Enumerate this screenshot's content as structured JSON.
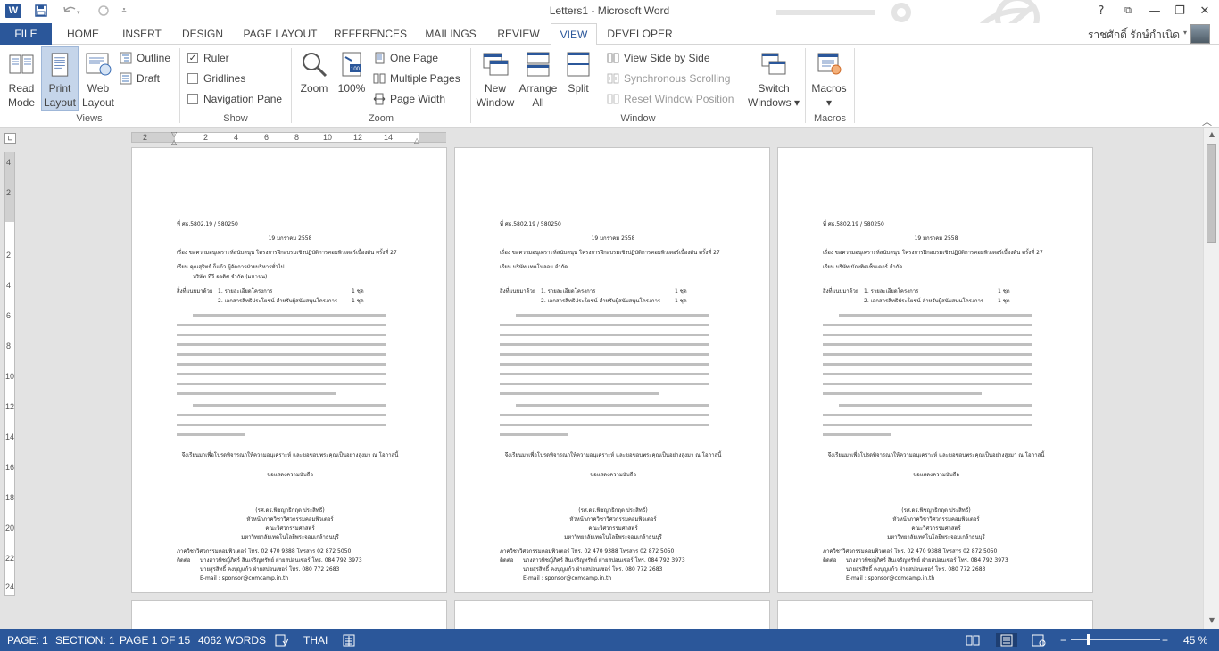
{
  "app": {
    "title": "Letters1 - Microsoft Word",
    "logo": "W",
    "colors": {
      "accent": "#2b579a",
      "ribbon_bg": "#ffffff",
      "workspace_bg": "#e3e3e3"
    }
  },
  "quick_access": {
    "save_icon": "save-icon",
    "undo_icon": "undo-icon",
    "redo_icon": "redo-icon",
    "customize_icon": "customize-qat-icon"
  },
  "window_controls": {
    "help": "?",
    "restore_ribbon": "⧉",
    "minimize": "—",
    "maximize": "❐",
    "close": "✕"
  },
  "tabs": {
    "file": "FILE",
    "items": [
      {
        "label": "HOME"
      },
      {
        "label": "INSERT"
      },
      {
        "label": "DESIGN"
      },
      {
        "label": "PAGE LAYOUT"
      },
      {
        "label": "REFERENCES"
      },
      {
        "label": "MAILINGS"
      },
      {
        "label": "REVIEW"
      },
      {
        "label": "VIEW",
        "active": true
      },
      {
        "label": "DEVELOPER"
      }
    ],
    "user_name": "ราชศักดิ์ รักษ์กำเนิด"
  },
  "ribbon": {
    "views": {
      "label": "Views",
      "read_mode": [
        "Read",
        "Mode"
      ],
      "print_layout": [
        "Print",
        "Layout"
      ],
      "web_layout": [
        "Web",
        "Layout"
      ],
      "outline": "Outline",
      "draft": "Draft"
    },
    "show": {
      "label": "Show",
      "ruler": "Ruler",
      "ruler_checked": true,
      "gridlines": "Gridlines",
      "gridlines_checked": false,
      "navigation_pane": "Navigation Pane",
      "navigation_pane_checked": false
    },
    "zoom": {
      "label": "Zoom",
      "zoom": "Zoom",
      "hundred": "100%",
      "one_page": "One Page",
      "multiple_pages": "Multiple Pages",
      "page_width": "Page Width"
    },
    "window": {
      "label": "Window",
      "new_window": [
        "New",
        "Window"
      ],
      "arrange_all": [
        "Arrange",
        "All"
      ],
      "split": "Split",
      "view_side_by_side": "View Side by Side",
      "synchronous_scrolling": "Synchronous Scrolling",
      "reset_window_position": "Reset Window Position",
      "switch_windows": [
        "Switch",
        "Windows ▾"
      ]
    },
    "macros": {
      "label": "Macros",
      "macros": [
        "Macros",
        "▾"
      ]
    }
  },
  "ruler": {
    "horizontal_numbers": [
      "2",
      "2",
      "4",
      "6",
      "8",
      "10",
      "12",
      "14"
    ],
    "vertical_numbers": [
      "4",
      "2",
      "2",
      "4",
      "6",
      "8",
      "10",
      "12",
      "14",
      "16",
      "18",
      "20",
      "22",
      "24"
    ]
  },
  "pages": [
    {
      "ref": "ที่ ศธ.5802.19 / 580250",
      "date": "19 มกราคม 2558",
      "subject": "เรื่อง   ขอความอนุเคราะห์สนับสนุน โครงการฝึกอบรมเชิงปฏิบัติการคอมพิวเตอร์เบื้องต้น ครั้งที่ 27",
      "to": "เรียน  คุณสุริทธ์ ก็แก้ว ผู้จัดการฝ่ายบริหารทั่วไป",
      "to2": "บริษัท ทีวี ออดิศ จำกัด (มหาชน)",
      "attach_label": "สิ่งที่แนบมาด้วย",
      "attach1": "1. รายละเอียดโครงการ",
      "attach2": "2. เอกสารสิทธิประโยชน์ สำหรับผู้สนับสนุนโครงการ",
      "qty": "1 ชุด",
      "closing": "จึงเรียนมาเพื่อโปรดพิจารณาให้ความอนุเคราะห์ และขอขอบพระคุณเป็นอย่างสูงมา ณ โอกาสนี้",
      "regards": "ขอแสดงความนับถือ",
      "signer": "(รศ.ดร.พิชญาธิกฤต ประสิทธิ์)",
      "position1": "หัวหน้าภาควิชาวิศวกรรมคอมพิวเตอร์",
      "position2": "คณะวิศวกรรมศาสตร์",
      "position3": "มหาวิทยาลัยเทคโนโลยีพระจอมเกล้าธนบุรี",
      "dept": "ภาควิชาวิศวกรรมคอมพิวเตอร์  โทร. 02 470 9388  โทรสาร 02 872 5050",
      "contact_label": "ติดต่อ",
      "contact1": "นางสาวพิชญ์ภิศร์  สินเจริญทรัพย์          ฝ่ายสปอนเซอร์  โทร. 084 792 3973",
      "contact2": "นายสุรสิทธิ์   คงบุญแก้ว                ฝ่ายสปอนเซอร์  โทร. 080 772 2683",
      "email": "E-mail : sponsor@comcamp.in.th"
    },
    {
      "ref": "ที่ ศธ.5802.19 / 580250",
      "date": "19 มกราคม 2558",
      "subject": "เรื่อง   ขอความอนุเคราะห์สนับสนุน โครงการฝึกอบรมเชิงปฏิบัติการคอมพิวเตอร์เบื้องต้น ครั้งที่ 27",
      "to": "เรียน  บริษัท เทคโนลอย จำกัด",
      "to2": "",
      "attach_label": "สิ่งที่แนบมาด้วย",
      "attach1": "1. รายละเอียดโครงการ",
      "attach2": "2. เอกสารสิทธิประโยชน์ สำหรับผู้สนับสนุนโครงการ",
      "qty": "1 ชุด",
      "closing": "จึงเรียนมาเพื่อโปรดพิจารณาให้ความอนุเคราะห์ และขอขอบพระคุณเป็นอย่างสูงมา ณ โอกาสนี้",
      "regards": "ขอแสดงความนับถือ",
      "signer": "(รศ.ดร.พิชญาธิกฤต ประสิทธิ์)",
      "position1": "หัวหน้าภาควิชาวิศวกรรมคอมพิวเตอร์",
      "position2": "คณะวิศวกรรมศาสตร์",
      "position3": "มหาวิทยาลัยเทคโนโลยีพระจอมเกล้าธนบุรี",
      "dept": "ภาควิชาวิศวกรรมคอมพิวเตอร์  โทร. 02 470 9388  โทรสาร 02 872 5050",
      "contact_label": "ติดต่อ",
      "contact1": "นางสาวพิชญ์ภิศร์  สินเจริญทรัพย์          ฝ่ายสปอนเซอร์  โทร. 084 792 3973",
      "contact2": "นายสุรสิทธิ์   คงบุญแก้ว                ฝ่ายสปอนเซอร์  โทร. 080 772 2683",
      "email": "E-mail : sponsor@comcamp.in.th"
    },
    {
      "ref": "ที่ ศธ.5802.19 / 580250",
      "date": "19 มกราคม 2558",
      "subject": "เรื่อง   ขอความอนุเคราะห์สนับสนุน โครงการฝึกอบรมเชิงปฏิบัติการคอมพิวเตอร์เบื้องต้น ครั้งที่ 27",
      "to": "เรียน  บริษัท บัณฑิตเซ็นเตอร์ จำกัด",
      "to2": "",
      "attach_label": "สิ่งที่แนบมาด้วย",
      "attach1": "1. รายละเอียดโครงการ",
      "attach2": "2. เอกสารสิทธิประโยชน์ สำหรับผู้สนับสนุนโครงการ",
      "qty": "1 ชุด",
      "closing": "จึงเรียนมาเพื่อโปรดพิจารณาให้ความอนุเคราะห์ และขอขอบพระคุณเป็นอย่างสูงมา ณ โอกาสนี้",
      "regards": "ขอแสดงความนับถือ",
      "signer": "(รศ.ดร.พิชญาธิกฤต ประสิทธิ์)",
      "position1": "หัวหน้าภาควิชาวิศวกรรมคอมพิวเตอร์",
      "position2": "คณะวิศวกรรมศาสตร์",
      "position3": "มหาวิทยาลัยเทคโนโลยีพระจอมเกล้าธนบุรี",
      "dept": "ภาควิชาวิศวกรรมคอมพิวเตอร์  โทร. 02 470 9388  โทรสาร 02 872 5050",
      "contact_label": "ติดต่อ",
      "contact1": "นางสาวพิชญ์ภิศร์  สินเจริญทรัพย์          ฝ่ายสปอนเซอร์  โทร. 084 792 3973",
      "contact2": "นายสุรสิทธิ์   คงบุญแก้ว                ฝ่ายสปอนเซอร์  โทร. 080 772 2683",
      "email": "E-mail : sponsor@comcamp.in.th"
    }
  ],
  "status": {
    "page": "PAGE: 1",
    "section": "SECTION: 1",
    "page_of": "PAGE 1 OF 15",
    "words": "4062 WORDS",
    "proofing_icon": "proofing-icon",
    "language": "THAI",
    "macro_icon": "macro-record-icon",
    "zoom_percent": "45 %",
    "zoom_minus": "−",
    "zoom_plus": "+",
    "zoom_level": 0.45
  }
}
